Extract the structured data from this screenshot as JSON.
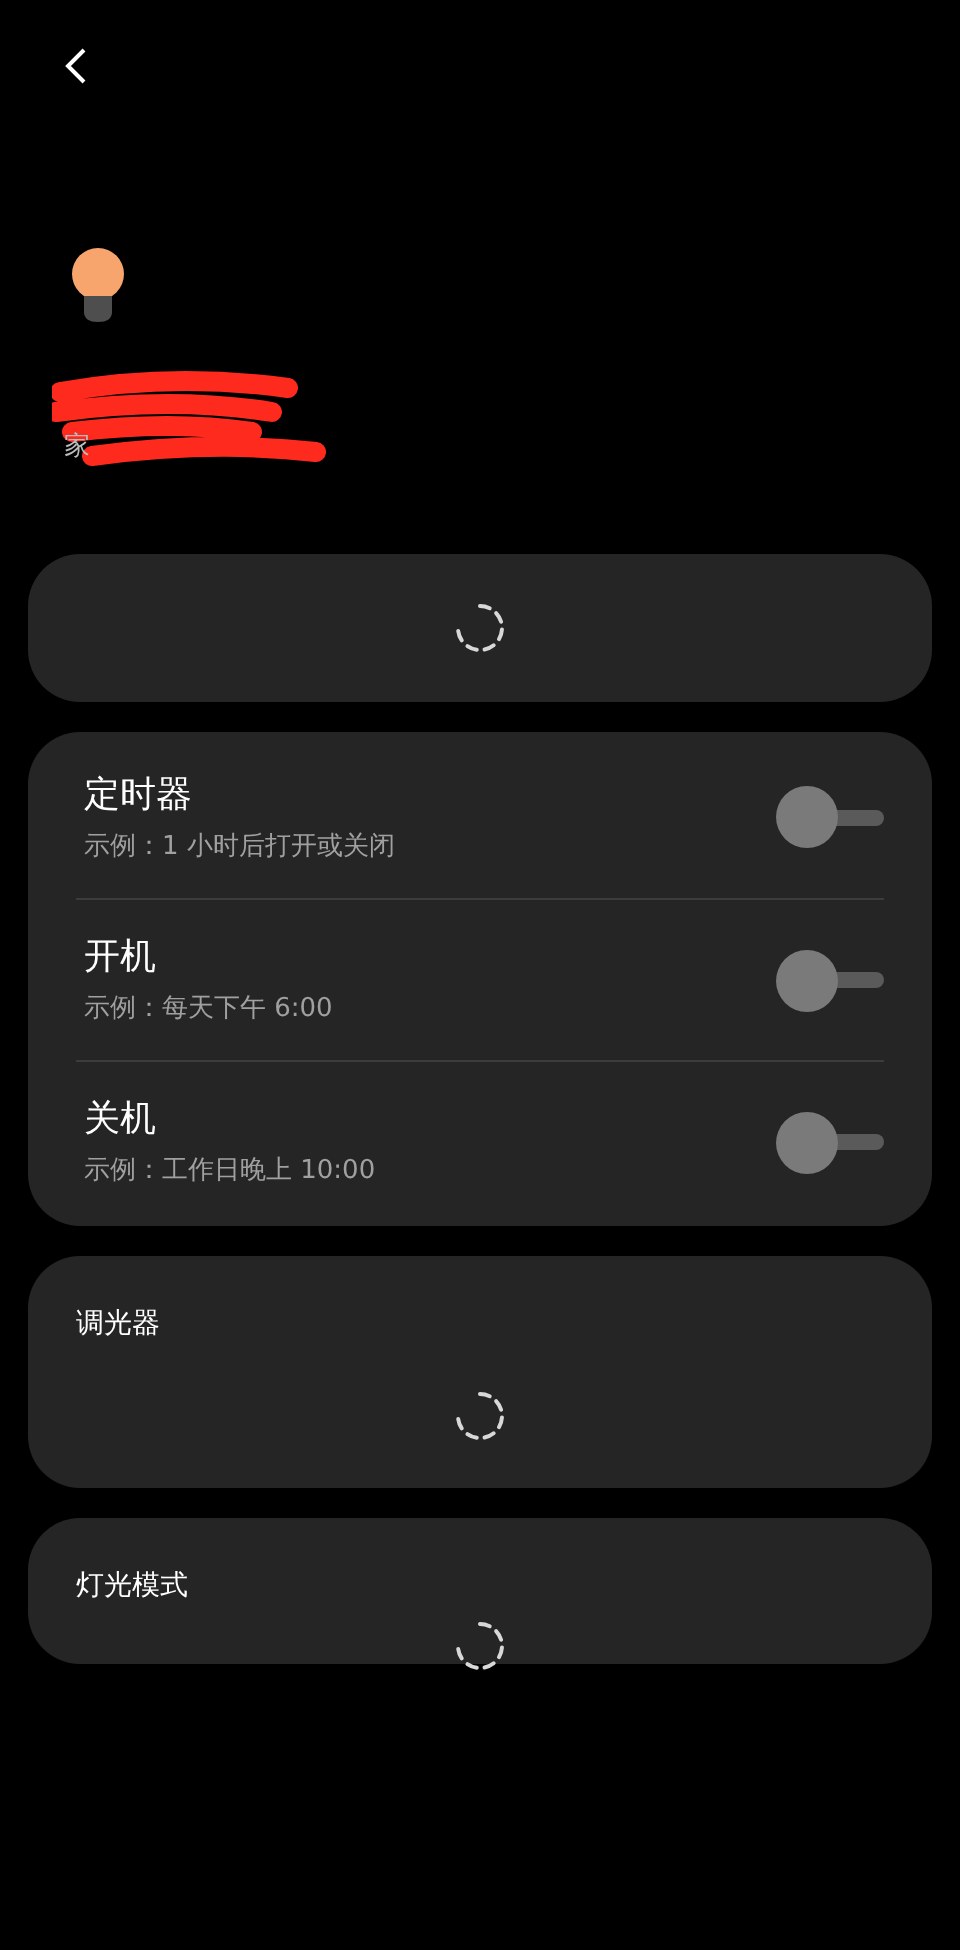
{
  "device": {
    "location": "家"
  },
  "schedules": [
    {
      "title": "定时器",
      "example": "示例：1 小时后打开或关闭",
      "on": false
    },
    {
      "title": "开机",
      "example": "示例：每天下午 6:00",
      "on": false
    },
    {
      "title": "关机",
      "example": "示例：工作日晚上 10:00",
      "on": false
    }
  ],
  "sections": [
    {
      "title": "调光器"
    },
    {
      "title": "灯光模式"
    }
  ]
}
